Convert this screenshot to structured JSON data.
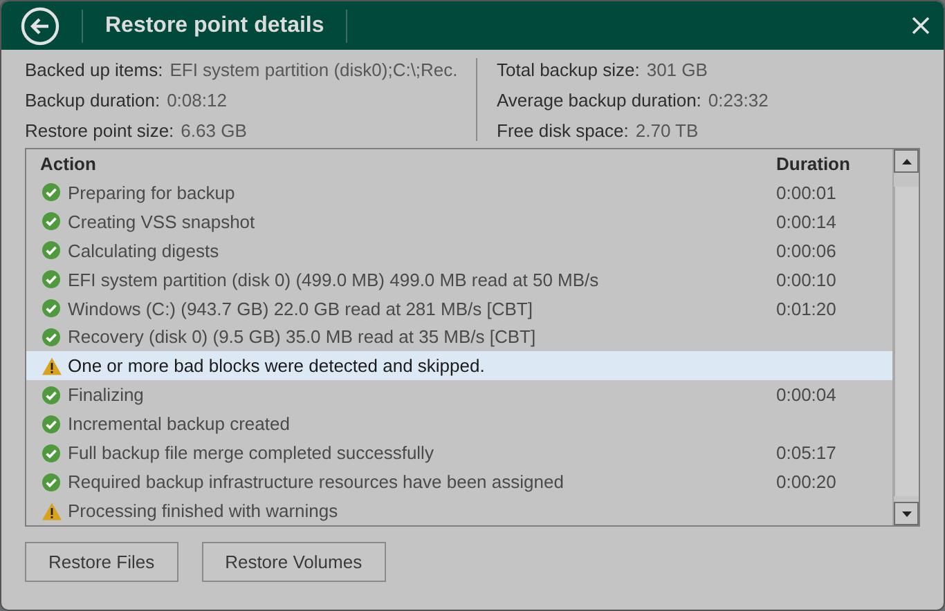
{
  "window": {
    "title": "Restore point details"
  },
  "info_left": [
    {
      "label": "Backed up items:",
      "value": "EFI system partition (disk0);C:\\;Rec."
    },
    {
      "label": "Backup duration:",
      "value": "0:08:12"
    },
    {
      "label": "Restore point size:",
      "value": "6.63 GB"
    }
  ],
  "info_right": [
    {
      "label": "Total backup size:",
      "value": "301 GB"
    },
    {
      "label": "Average backup duration:",
      "value": "0:23:32"
    },
    {
      "label": "Free disk space:",
      "value": "2.70 TB"
    }
  ],
  "table": {
    "columns": [
      "Action",
      "Duration"
    ],
    "rows": [
      {
        "kind": "success",
        "action": "Preparing for backup",
        "duration": "0:00:01",
        "selected": false
      },
      {
        "kind": "success",
        "action": "Creating VSS snapshot",
        "duration": "0:00:14",
        "selected": false
      },
      {
        "kind": "success",
        "action": "Calculating digests",
        "duration": "0:00:06",
        "selected": false
      },
      {
        "kind": "success",
        "action": "EFI system partition (disk 0) (499.0 MB) 499.0 MB read at 50 MB/s",
        "duration": "0:00:10",
        "selected": false
      },
      {
        "kind": "success",
        "action": "Windows (C:) (943.7 GB) 22.0 GB read at 281 MB/s [CBT]",
        "duration": "0:01:20",
        "selected": false
      },
      {
        "kind": "success",
        "action": "Recovery (disk 0) (9.5 GB) 35.0 MB read at 35 MB/s [CBT]",
        "selected": false
      },
      {
        "kind": "warning",
        "action": "One or more bad blocks were detected and skipped.",
        "selected": true
      },
      {
        "kind": "success",
        "action": "Finalizing",
        "duration": "0:00:04",
        "selected": false
      },
      {
        "kind": "success",
        "action": "Incremental backup created",
        "selected": false
      },
      {
        "kind": "success",
        "action": "Full backup file merge completed successfully",
        "duration": "0:05:17",
        "selected": false
      },
      {
        "kind": "success",
        "action": "Required backup infrastructure resources have been assigned",
        "duration": "0:00:20",
        "selected": false
      },
      {
        "kind": "warning",
        "action": "Processing finished with warnings",
        "selected": false
      }
    ]
  },
  "buttons": [
    "Restore Files",
    "Restore Volumes"
  ]
}
